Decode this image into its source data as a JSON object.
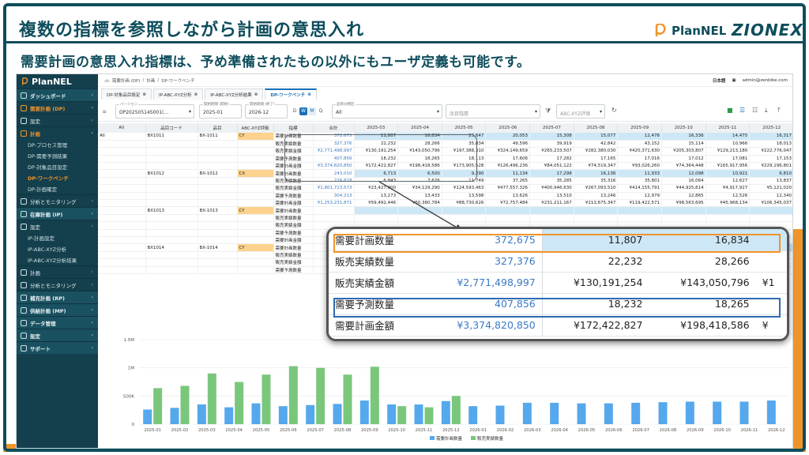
{
  "slide": {
    "title": "複数の指標を参照しながら計画の意思入れ",
    "subtitle": "需要計画の意思入れ指標は、予め準備されたもの以外にもユーザ定義も可能です。",
    "brand_plannel": "PlanNEL",
    "brand_zionex": "ZIONEX"
  },
  "sidebar": {
    "logo": "PlanNEL",
    "items": [
      {
        "label": "ダッシュボード",
        "type": "main"
      },
      {
        "label": "需要計画 (DP)",
        "type": "active-main"
      },
      {
        "label": "設定",
        "type": "item"
      },
      {
        "label": "計画",
        "type": "active-main"
      },
      {
        "label": "DP-プロセス管理",
        "type": "sub"
      },
      {
        "label": "DP-需要予測結果",
        "type": "sub"
      },
      {
        "label": "DP-対象品目設定",
        "type": "sub"
      },
      {
        "label": "DP-ワークベンチ",
        "type": "sub-active"
      },
      {
        "label": "DP-計画確定",
        "type": "sub"
      },
      {
        "label": "分析とモニタリング",
        "type": "item"
      },
      {
        "label": "在庫計画 (IP)",
        "type": "main"
      },
      {
        "label": "設定",
        "type": "item"
      },
      {
        "label": "IP-計画設定",
        "type": "sub"
      },
      {
        "label": "IP-ABC-XYZ分析",
        "type": "sub"
      },
      {
        "label": "IP-ABC-XYZ分析結果",
        "type": "sub"
      },
      {
        "label": "計画",
        "type": "item"
      },
      {
        "label": "分析とモニタリング",
        "type": "item"
      },
      {
        "label": "補充計画 (RP)",
        "type": "main"
      },
      {
        "label": "供給計画 (MP)",
        "type": "main"
      },
      {
        "label": "データ管理",
        "type": "main"
      },
      {
        "label": "設定",
        "type": "main"
      },
      {
        "label": "サポート",
        "type": "main"
      }
    ]
  },
  "topbar": {
    "breadcrumb": [
      "需要計画 (DP)",
      "計画",
      "DP-ワークベンチ"
    ],
    "language": "日本語",
    "user": "admin@zenbike.com"
  },
  "tabs": [
    {
      "label": "DP-対象品目設定",
      "active": false
    },
    {
      "label": "IP-ABC-XYZ分析",
      "active": false
    },
    {
      "label": "IP-ABC-XYZ分析結果",
      "active": false
    },
    {
      "label": "DP-ワークベンチ",
      "active": true
    }
  ],
  "filters": {
    "version_label": "バージョン",
    "version": "DP20250514S001(...",
    "start_label": "開始期間 (開始)",
    "start": "2025-01",
    "end_label": "開始期間 (終了)",
    "end": "2026-12",
    "period_buttons": [
      "D",
      "W",
      "M",
      "Q"
    ],
    "category_label": "品目分類区",
    "category": "All",
    "item_group_placeholder": "品目階層",
    "abc_placeholder": "ABC-XYZ評価"
  },
  "grid": {
    "headers": [
      "All",
      "品目コード",
      "品目",
      "ABC-XYZ評価",
      "指標",
      "合計",
      "2025-03",
      "2025-04",
      "2025-05",
      "2025-06",
      "2025-07",
      "2025-08",
      "2025-09",
      "2025-10",
      "2025-11",
      "2025-12"
    ],
    "rows": [
      {
        "group": "All",
        "code": "BX1011",
        "item": "BX-1011",
        "abc": "CY",
        "metric": "需要計画数量",
        "total": "372,675",
        "vals": [
          "11,807",
          "16,834",
          "23,647",
          "20,053",
          "15,308",
          "15,077",
          "12,476",
          "16,336",
          "14,475",
          "16,317"
        ],
        "hl": true
      },
      {
        "group": "",
        "code": "",
        "item": "",
        "abc": "",
        "metric": "販売実績数量",
        "total": "327,376",
        "vals": [
          "22,232",
          "28,266",
          "35,834",
          "49,596",
          "39,919",
          "42,842",
          "43,152",
          "15,114",
          "10,966",
          "18,013"
        ],
        "hl": false
      },
      {
        "group": "",
        "code": "",
        "item": "",
        "abc": "",
        "metric": "販売実績金額",
        "total": "¥2,771,498,997",
        "vals": [
          "¥130,191,254",
          "¥143,050,796",
          "¥197,388,310",
          "¥324,149,659",
          "¥265,233,507",
          "¥282,380,030",
          "¥420,371,630",
          "¥205,303,807",
          "¥129,213,180",
          "¥222,776,047"
        ],
        "hl": false
      },
      {
        "group": "",
        "code": "",
        "item": "",
        "abc": "",
        "metric": "需要予測数量",
        "total": "407,856",
        "vals": [
          "18,232",
          "18,265",
          "18,113",
          "17,606",
          "17,282",
          "17,165",
          "17,016",
          "17,012",
          "17,081",
          "17,153"
        ],
        "hl": false
      },
      {
        "group": "",
        "code": "",
        "item": "",
        "abc": "",
        "metric": "需要計画金額",
        "total": "¥3,374,820,850",
        "vals": [
          "¥172,422,827",
          "¥198,418,586",
          "¥173,905,528",
          "¥126,496,236",
          "¥84,051,122",
          "¥74,519,347",
          "¥93,026,260",
          "¥74,364,448",
          "¥165,917,956",
          "¥229,196,801"
        ],
        "hl": false
      },
      {
        "group": "",
        "code": "BX1012",
        "item": "BX-1012",
        "abc": "CX",
        "metric": "需要計画数量",
        "total": "243,010",
        "vals": [
          "6,713",
          "6,500",
          "9,290",
          "11,134",
          "17,298",
          "16,136",
          "11,933",
          "12,098",
          "10,921",
          "6,810"
        ],
        "hl": true
      },
      {
        "group": "",
        "code": "",
        "item": "",
        "abc": "",
        "metric": "販売実績数量",
        "total": "226,618",
        "vals": [
          "6,843",
          "7,676",
          "11,749",
          "37,265",
          "35,285",
          "35,316",
          "35,801",
          "16,064",
          "12,627",
          "13,837"
        ],
        "hl": false
      },
      {
        "group": "",
        "code": "",
        "item": "",
        "abc": "",
        "metric": "販売実績金額",
        "total": "¥1,801,713,573",
        "vals": [
          "¥23,427,000",
          "¥34,129,290",
          "¥124,593,463",
          "¥477,557,326",
          "¥400,946,630",
          "¥267,093,510",
          "¥414,155,791",
          "¥44,925,614",
          "¥4,917,927",
          "¥5,121,020"
        ],
        "hl": false
      },
      {
        "group": "",
        "code": "",
        "item": "",
        "abc": "",
        "metric": "需要予測数量",
        "total": "304,213",
        "vals": [
          "13,273",
          "13,433",
          "13,598",
          "13,626",
          "13,510",
          "13,246",
          "12,979",
          "12,865",
          "12,526",
          "12,340"
        ],
        "hl": false
      },
      {
        "group": "",
        "code": "",
        "item": "",
        "abc": "",
        "metric": "需要計画金額",
        "total": "¥1,253,231,871",
        "vals": [
          "¥59,492,446",
          "¥60,380,784",
          "¥88,730,626",
          "¥72,757,484",
          "¥231,211,167",
          "¥213,675,347",
          "¥119,422,571",
          "¥98,563,695",
          "¥45,968,134",
          "¥106,345,037"
        ],
        "hl": false
      },
      {
        "group": "",
        "code": "BX1013",
        "item": "BX-1013",
        "abc": "CY",
        "metric": "需要計画数量",
        "total": "",
        "vals": [],
        "hl": true
      },
      {
        "group": "",
        "code": "",
        "item": "",
        "abc": "",
        "metric": "販売実績数量",
        "total": "",
        "vals": [],
        "hl": false
      },
      {
        "group": "",
        "code": "",
        "item": "",
        "abc": "",
        "metric": "販売実績金額",
        "total": "",
        "vals": [],
        "hl": false
      },
      {
        "group": "",
        "code": "",
        "item": "",
        "abc": "",
        "metric": "需要予測数量",
        "total": "",
        "vals": [],
        "hl": false
      },
      {
        "group": "",
        "code": "",
        "item": "",
        "abc": "",
        "metric": "需要計画金額",
        "total": "",
        "vals": [],
        "hl": false
      },
      {
        "group": "",
        "code": "BX1014",
        "item": "BX-1014",
        "abc": "CY",
        "metric": "需要計画数量",
        "total": "",
        "vals": [],
        "hl": true
      },
      {
        "group": "",
        "code": "",
        "item": "",
        "abc": "",
        "metric": "販売実績数量",
        "total": "",
        "vals": [],
        "hl": false
      },
      {
        "group": "",
        "code": "",
        "item": "",
        "abc": "",
        "metric": "販売実績金額",
        "total": "",
        "vals": [],
        "hl": false
      },
      {
        "group": "",
        "code": "",
        "item": "",
        "abc": "",
        "metric": "需要予測数量",
        "total": "",
        "vals": [],
        "hl": false
      }
    ]
  },
  "zoom": {
    "rows": [
      {
        "metric": "需要計画数量",
        "total": "372,675",
        "v1": "11,807",
        "v2": "16,834",
        "edge": "",
        "hl": true
      },
      {
        "metric": "販売実績数量",
        "total": "327,376",
        "v1": "22,232",
        "v2": "28,266",
        "edge": "",
        "hl": false
      },
      {
        "metric": "販売実績金額",
        "total": "¥2,771,498,997",
        "v1": "¥130,191,254",
        "v2": "¥143,050,796",
        "edge": "¥1",
        "hl": false
      },
      {
        "metric": "需要予測数量",
        "total": "407,856",
        "v1": "18,232",
        "v2": "18,265",
        "edge": "",
        "hl": false
      },
      {
        "metric": "需要計画金額",
        "total": "¥3,374,820,850",
        "v1": "¥172,422,827",
        "v2": "¥198,418,586",
        "edge": "¥",
        "hl": false
      }
    ]
  },
  "chart_data": {
    "type": "bar",
    "categories": [
      "2025-01",
      "2025-02",
      "2025-03",
      "2025-04",
      "2025-05",
      "2025-06",
      "2025-07",
      "2025-08",
      "2025-09",
      "2025-10",
      "2025-11",
      "2025-12",
      "2026-01",
      "2026-02",
      "2026-03",
      "2026-04",
      "2026-05",
      "2026-06",
      "2026-07",
      "2026-08",
      "2026-09",
      "2026-10",
      "2026-11",
      "2026-12"
    ],
    "series": [
      {
        "name": "需要計画数量",
        "color": "#55a8ec",
        "values": [
          260000,
          290000,
          350000,
          300000,
          370000,
          320000,
          340000,
          360000,
          420000,
          350000,
          350000,
          410000,
          320000,
          330000,
          380000,
          380000,
          370000,
          370000,
          380000,
          390000,
          400000,
          400000,
          400000,
          420000
        ]
      },
      {
        "name": "販売実績数量",
        "color": "#7ac77c",
        "values": [
          640000,
          680000,
          900000,
          750000,
          880000,
          1030000,
          1000000,
          880000,
          1020000,
          320000,
          300000,
          500000,
          0,
          0,
          0,
          0,
          0,
          0,
          0,
          0,
          0,
          0,
          0,
          0
        ]
      }
    ],
    "yticks": [
      "1.5M",
      "1M",
      "500K",
      "0"
    ],
    "ylim": [
      0,
      1500000
    ]
  }
}
